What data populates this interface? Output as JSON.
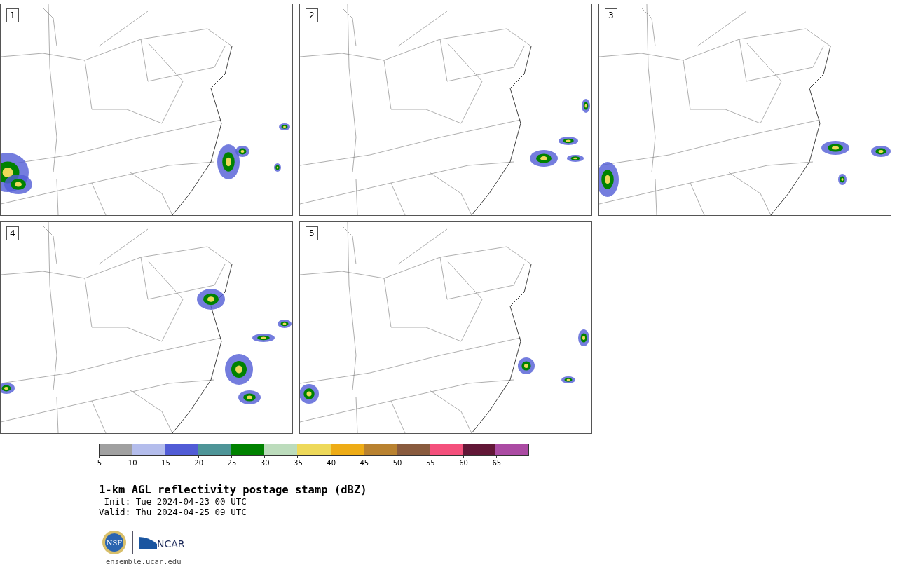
{
  "panels": [
    {
      "number": "1"
    },
    {
      "number": "2"
    },
    {
      "number": "3"
    },
    {
      "number": "4"
    },
    {
      "number": "5"
    }
  ],
  "colorbar": {
    "bins": [
      {
        "color": "#a0a0a0"
      },
      {
        "color": "#b4bdec"
      },
      {
        "color": "#515cd6"
      },
      {
        "color": "#4e9598"
      },
      {
        "color": "#008200"
      },
      {
        "color": "#bcdcbc"
      },
      {
        "color": "#eed95a"
      },
      {
        "color": "#eeac16"
      },
      {
        "color": "#b98230"
      },
      {
        "color": "#895b3e"
      },
      {
        "color": "#f4507c"
      },
      {
        "color": "#621737"
      },
      {
        "color": "#ab4ba3"
      }
    ],
    "ticks": [
      "5",
      "10",
      "15",
      "20",
      "25",
      "30",
      "35",
      "40",
      "45",
      "50",
      "55",
      "60",
      "65"
    ]
  },
  "title": "1-km AGL reflectivity postage stamp (dBZ)",
  "init": " Init: Tue 2024-04-23 00 UTC",
  "valid": "Valid: Thu 2024-04-25 09 UTC",
  "logos": {
    "nsf": "NSF",
    "ncar": "NCAR"
  },
  "url": "ensemble.ucar.edu"
}
